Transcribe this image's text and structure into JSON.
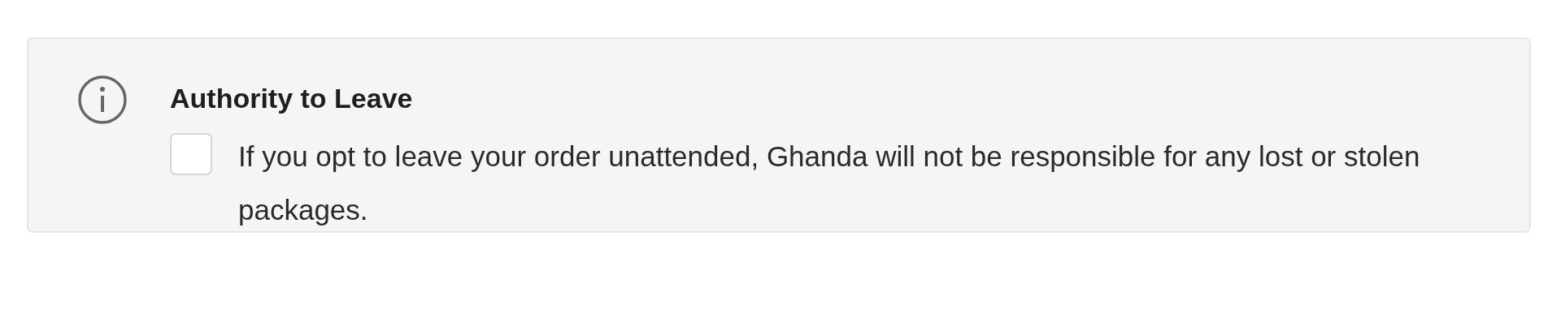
{
  "notice": {
    "title": "Authority to Leave",
    "checkbox": {
      "checked": false,
      "label": "If you opt to leave your order unattended, Ghanda will not be responsible for any lost or stolen packages."
    }
  }
}
